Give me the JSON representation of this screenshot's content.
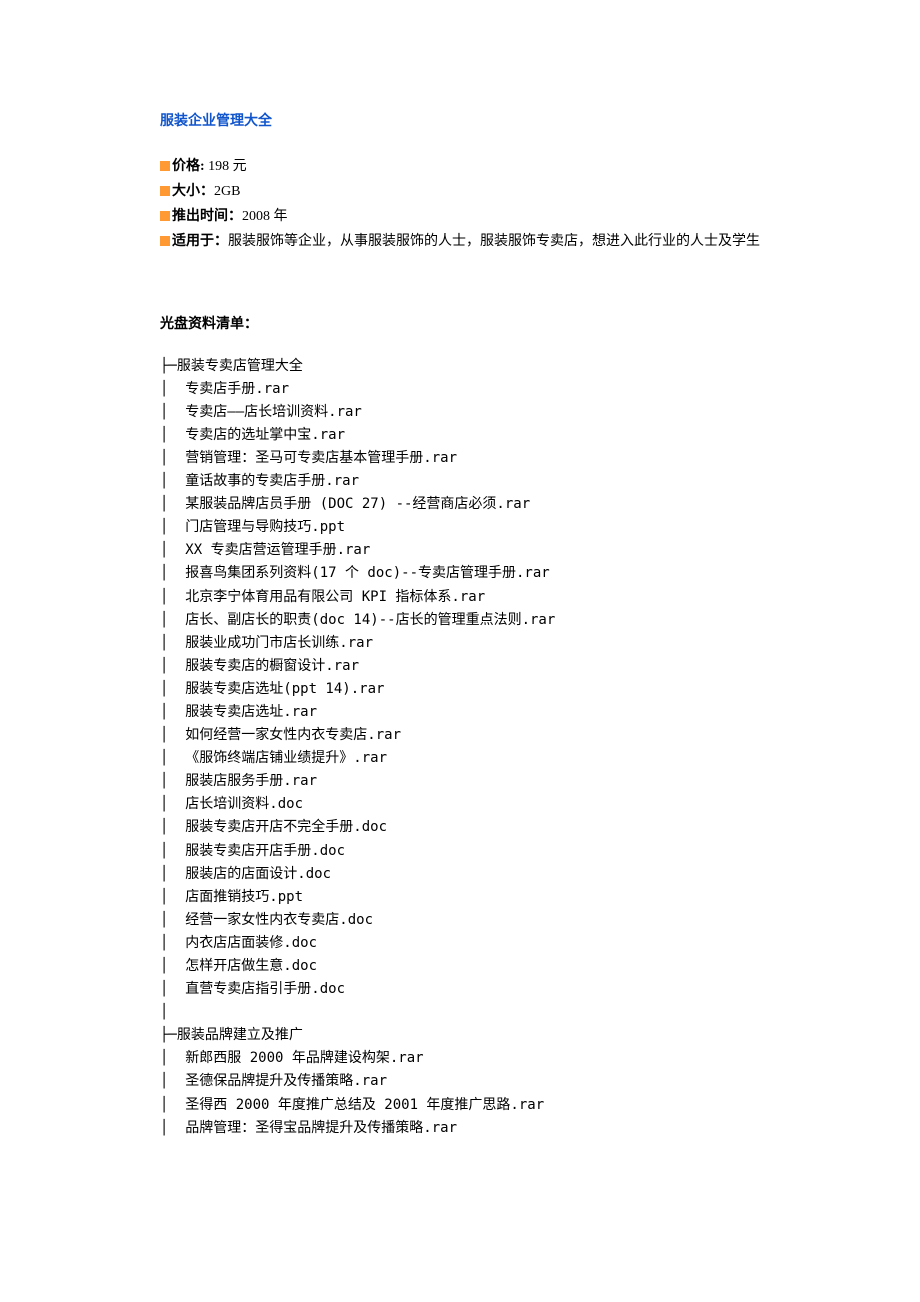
{
  "title": "服装企业管理大全",
  "meta": [
    {
      "label": "价格:",
      "value": " 198 元"
    },
    {
      "label": "大小：",
      "value": "2GB"
    },
    {
      "label": "推出时间：",
      "value": "2008 年"
    },
    {
      "label": "适用于：",
      "value": "服装服饰等企业，从事服装服饰的人士，服装服饰专卖店，想进入此行业的人士及学生"
    }
  ],
  "listing_header": "光盘资料清单：",
  "tree_lines": [
    "├─服装专卖店管理大全",
    "│  专卖店手册.rar",
    "│  专卖店——店长培训资料.rar",
    "│  专卖店的选址掌中宝.rar",
    "│  营销管理：圣马可专卖店基本管理手册.rar",
    "│  童话故事的专卖店手册.rar",
    "│  某服装品牌店员手册 (DOC 27) --经营商店必须.rar",
    "│  门店管理与导购技巧.ppt",
    "│  XX 专卖店营运管理手册.rar",
    "│  报喜鸟集团系列资料(17 个 doc)--专卖店管理手册.rar",
    "│  北京李宁体育用品有限公司 KPI 指标体系.rar",
    "│  店长、副店长的职责(doc 14)--店长的管理重点法则.rar",
    "│  服装业成功门市店长训练.rar",
    "│  服装专卖店的橱窗设计.rar",
    "│  服装专卖店选址(ppt 14).rar",
    "│  服装专卖店选址.rar",
    "│  如何经营一家女性内衣专卖店.rar",
    "│  《服饰终端店铺业绩提升》.rar",
    "│  服装店服务手册.rar",
    "│  店长培训资料.doc",
    "│  服装专卖店开店不完全手册.doc",
    "│  服装专卖店开店手册.doc",
    "│  服装店的店面设计.doc",
    "│  店面推销技巧.ppt",
    "│  经营一家女性内衣专卖店.doc",
    "│  内衣店店面装修.doc",
    "│  怎样开店做生意.doc",
    "│  直营专卖店指引手册.doc",
    "│",
    "├─服装品牌建立及推广",
    "│  新郎西服 2000 年品牌建设构架.rar",
    "│  圣德保品牌提升及传播策略.rar",
    "│  圣得西 2000 年度推广总结及 2001 年度推广思路.rar",
    "│  品牌管理：圣得宝品牌提升及传播策略.rar"
  ]
}
